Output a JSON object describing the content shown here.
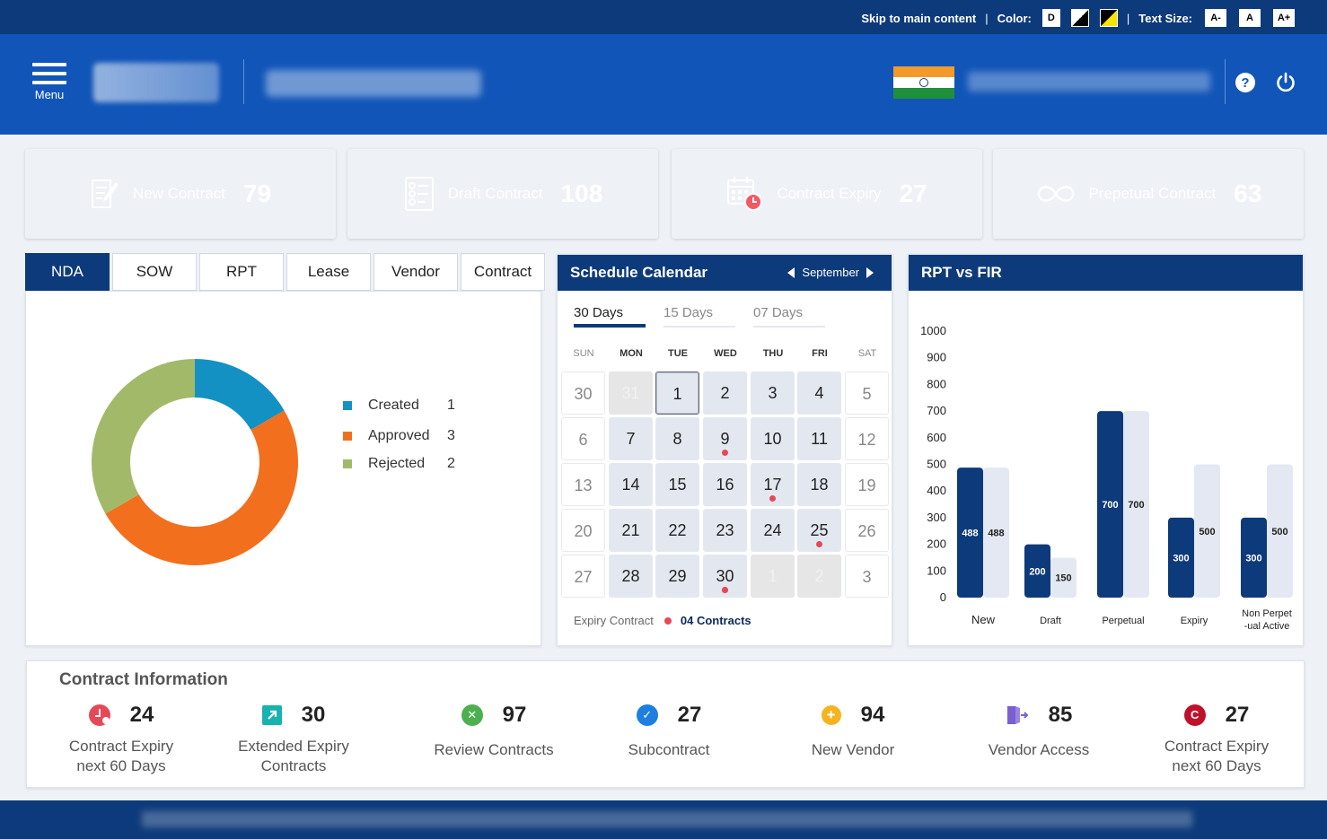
{
  "utility": {
    "skip_link": "Skip to main content",
    "color_label": "Color:",
    "color_default": "D",
    "text_size_label": "Text Size:",
    "size_small": "A-",
    "size_normal": "A",
    "size_large": "A+",
    "separator": "|"
  },
  "header": {
    "menu_label": "Menu"
  },
  "stats": [
    {
      "label": "New Contract",
      "value": "79",
      "color": "#3b8ee0"
    },
    {
      "label": "Draft Contract",
      "value": "108",
      "color": "#11bdb8"
    },
    {
      "label": "Contract Expiry",
      "value": "27",
      "color": "#f55863"
    },
    {
      "label": "Prepetual Contract",
      "value": "63",
      "color": "#2f8f4a"
    }
  ],
  "tabs": [
    "NDA",
    "SOW",
    "RPT",
    "Lease",
    "Vendor",
    "Contract"
  ],
  "donut": {
    "items": [
      {
        "name": "Created",
        "value": 1,
        "color": "#1491c3"
      },
      {
        "name": "Approved",
        "value": 3,
        "color": "#f26f1d"
      },
      {
        "name": "Rejected",
        "value": 2,
        "color": "#a3b96a"
      }
    ]
  },
  "calendar": {
    "title": "Schedule Calendar",
    "month": "September",
    "ranges": [
      "30 Days",
      "15 Days",
      "07 Days"
    ],
    "weekdays": [
      "SUN",
      "MON",
      "TUE",
      "WED",
      "THU",
      "FRI",
      "SAT"
    ],
    "days": [
      [
        "30",
        "31",
        "1",
        "2",
        "3",
        "4",
        "5"
      ],
      [
        "6",
        "7",
        "8",
        "9",
        "10",
        "11",
        "12"
      ],
      [
        "13",
        "14",
        "15",
        "16",
        "17",
        "18",
        "19"
      ],
      [
        "20",
        "21",
        "22",
        "23",
        "24",
        "25",
        "26"
      ],
      [
        "27",
        "28",
        "29",
        "30",
        "1",
        "2",
        "3"
      ]
    ],
    "events": [
      "9",
      "17",
      "25",
      "30"
    ],
    "today": "1",
    "footer_label": "Expiry Contract",
    "footer_count": "04 Contracts"
  },
  "chart_title": "RPT vs FIR",
  "chart_data": {
    "type": "bar",
    "categories": [
      "New",
      "Draft",
      "Perpetual",
      "Expiry",
      "Non Perpet -ual Active"
    ],
    "series": [
      {
        "values": [
          488,
          200,
          700,
          300,
          300
        ],
        "color": "#0d3a7a"
      },
      {
        "values": [
          488,
          150,
          700,
          500,
          500
        ],
        "color": "#e3e8f2"
      }
    ],
    "yticks": [
      0,
      100,
      200,
      300,
      400,
      500,
      600,
      700,
      800,
      900,
      1000
    ],
    "ylim": [
      0,
      1000
    ]
  },
  "info": {
    "title": "Contract Information",
    "items": [
      {
        "num": "24",
        "line1": "Contract  Expiry",
        "line2": "next 60 Days",
        "icon": "clock-icon",
        "color": "#e64857"
      },
      {
        "num": "30",
        "line1": "Extended Expiry",
        "line2": "Contracts",
        "icon": "arrow-up-right-icon",
        "color": "#17b3b0"
      },
      {
        "num": "97",
        "line1": "Review Contracts",
        "line2": "",
        "icon": "cross-circle-icon",
        "color": "#4caf50"
      },
      {
        "num": "27",
        "line1": "Subcontract",
        "line2": "",
        "icon": "check-circle-icon",
        "color": "#1e7fe0"
      },
      {
        "num": "94",
        "line1": "New Vendor",
        "line2": "",
        "icon": "plus-circle-icon",
        "color": "#f5b320"
      },
      {
        "num": "85",
        "line1": "Vendor Access",
        "line2": "",
        "icon": "door-exit-icon",
        "color": "#7a5fd0"
      },
      {
        "num": "27",
        "line1": "Contract  Expiry",
        "line2": "next 60 Days",
        "icon": "copyright-c-icon",
        "color": "#c0112b"
      }
    ]
  }
}
